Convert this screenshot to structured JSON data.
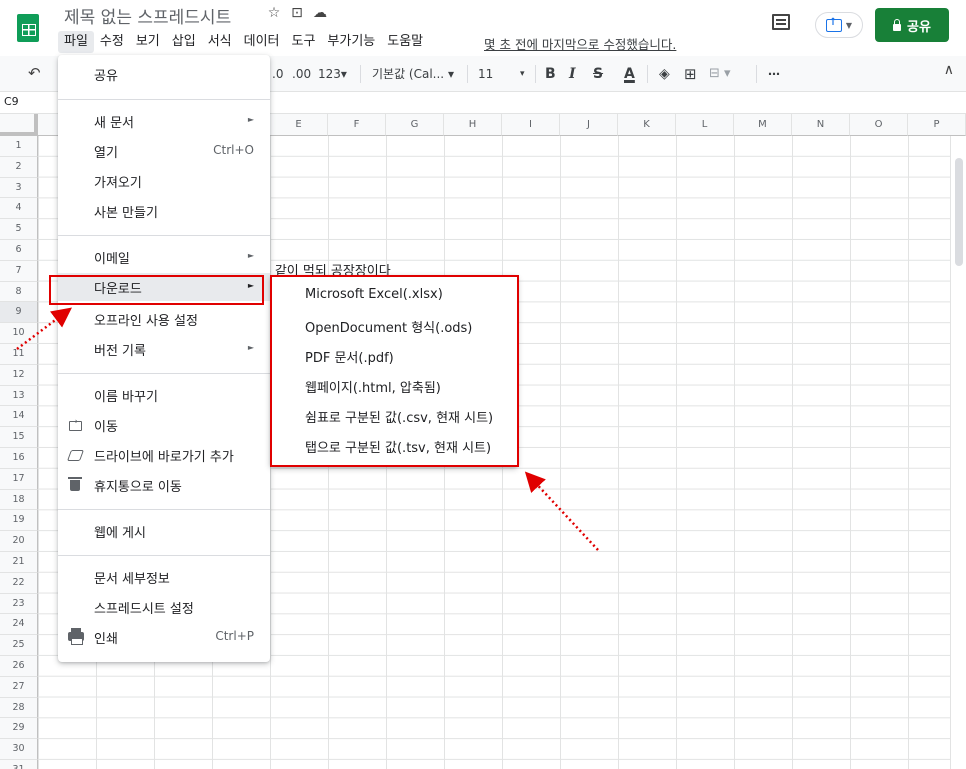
{
  "app": {
    "title": "제목 없는 스프레드시트",
    "title_icons": [
      "star-icon",
      "move-to-folder-icon",
      "cloud-status-icon"
    ],
    "last_edit": "몇 초 전에 마지막으로 수정했습니다.",
    "share_label": "공유"
  },
  "menubar": [
    "파일",
    "수정",
    "보기",
    "삽입",
    "서식",
    "데이터",
    "도구",
    "부가기능",
    "도움말"
  ],
  "toolbar": {
    "decimal_decrease": ".0",
    "decimal_increase": ".00",
    "number_format": "123▾",
    "font": "기본값 (Cal... ▾",
    "font_size": "11",
    "font_size_caret": "▾",
    "bold": "B",
    "italic": "I",
    "strike": "S",
    "text_color": "A",
    "more": "⋯"
  },
  "name_box": "C9",
  "grid": {
    "columns": [
      "E",
      "F",
      "G",
      "H",
      "I",
      "J",
      "K",
      "L",
      "M",
      "N",
      "O",
      "P"
    ],
    "rows": [
      "1",
      "2",
      "3",
      "4",
      "5",
      "6",
      "7",
      "8",
      "9",
      "10",
      "11",
      "12",
      "13",
      "14",
      "15",
      "16",
      "17",
      "18",
      "19",
      "20",
      "21",
      "22",
      "23",
      "24",
      "25",
      "26",
      "27",
      "28",
      "29",
      "30",
      "31"
    ],
    "visible_text": "- 같이 먹되 공장장이다"
  },
  "file_menu": {
    "items": {
      "share": "공유",
      "new": "새 문서",
      "open": "열기",
      "open_shortcut": "Ctrl+O",
      "import": "가져오기",
      "copy": "사본 만들기",
      "email": "이메일",
      "download": "다운로드",
      "offline": "오프라인 사용 설정",
      "version": "버전 기록",
      "rename": "이름 바꾸기",
      "move": "이동",
      "shortcut": "드라이브에 바로가기 추가",
      "trash": "휴지통으로 이동",
      "publish": "웹에 게시",
      "details": "문서 세부정보",
      "settings": "스프레드시트 설정",
      "print": "인쇄",
      "print_shortcut": "Ctrl+P"
    },
    "submenu_arrow": "►"
  },
  "download_submenu": [
    "Microsoft Excel(.xlsx)",
    "OpenDocument 형식(.ods)",
    "PDF 문서(.pdf)",
    "웹페이지(.html, 압축됨)",
    "쉼표로 구분된 값(.csv, 현재 시트)",
    "탭으로 구분된 값(.tsv, 현재 시트)"
  ],
  "colors": {
    "accent": "#188038",
    "annotation": "#e00000"
  }
}
